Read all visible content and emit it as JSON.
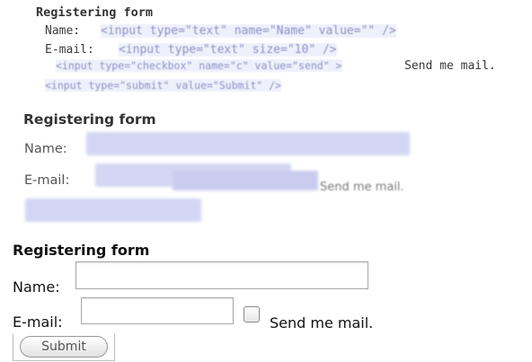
{
  "source_view": {
    "title": "Registering form",
    "name_label": "Name:",
    "name_code": "<input type=\"text\" name=\"Name\" value=\"\" />",
    "email_label": "E-mail:",
    "email_code": "<input type=\"text\" size=\"10\" />",
    "checkbox_code": "<input type=\"checkbox\" name=\"c\" value=\"send\" >",
    "send_label": "Send me mail.",
    "submit_code": "<input type=\"submit\" value=\"Submit\" />"
  },
  "blurred_view": {
    "title": "Registering form",
    "name_label": "Name:",
    "email_label": "E-mail:",
    "send_label": "Send me mail."
  },
  "rendered_form": {
    "title": "Registering form",
    "name_label": "Name:",
    "email_label": "E-mail:",
    "send_label": "Send me mail.",
    "submit_label": "Submit",
    "name_value": "",
    "email_value": ""
  }
}
